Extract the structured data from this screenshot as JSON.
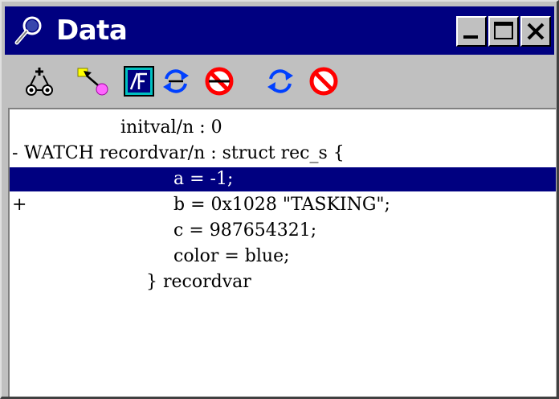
{
  "window": {
    "title": "Data"
  },
  "toolbar": {
    "buttons": [
      {
        "icon": "add-watch-icon"
      },
      {
        "icon": "edit-expression-icon"
      },
      {
        "icon": "format-icon"
      },
      {
        "icon": "refresh-icon"
      },
      {
        "icon": "remove-watch-icon"
      },
      {
        "icon": "refresh-all-icon"
      },
      {
        "icon": "remove-all-icon"
      }
    ]
  },
  "rows": [
    {
      "marker": "",
      "text": "initval/n : 0"
    },
    {
      "marker": "-",
      "text": "WATCH recordvar/n : struct rec_s {"
    },
    {
      "marker": "",
      "text": "a = -1;"
    },
    {
      "marker": "+",
      "text": "b = 0x1028 \"TASKING\";"
    },
    {
      "marker": "",
      "text": "c = 987654321;"
    },
    {
      "marker": "",
      "text": "color = blue;"
    },
    {
      "marker": "",
      "text": "} recordvar"
    }
  ],
  "selected_row": 2,
  "colors": {
    "title_bar": "#000080",
    "selection": "#000080",
    "face": "#c0c0c0"
  }
}
